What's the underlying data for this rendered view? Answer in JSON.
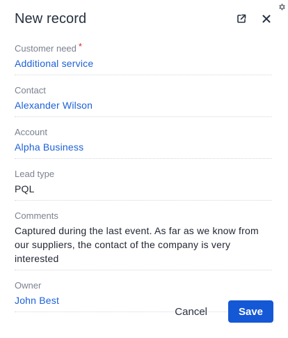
{
  "dialog": {
    "title": "New record"
  },
  "icons": {
    "settings": "gear-icon",
    "open_new": "open-in-new-icon",
    "close": "close-icon"
  },
  "fields": [
    {
      "label": "Customer need",
      "value": "Additional service",
      "required": true,
      "link": true
    },
    {
      "label": "Contact",
      "value": "Alexander Wilson",
      "required": false,
      "link": true
    },
    {
      "label": "Account",
      "value": "Alpha Business",
      "required": false,
      "link": true
    },
    {
      "label": "Lead type",
      "value": "PQL",
      "required": false,
      "link": false
    },
    {
      "label": "Comments",
      "value": "Captured during the last event. As far as we know from our suppliers, the contact of the company is very interested",
      "required": false,
      "link": false
    },
    {
      "label": "Owner",
      "value": "John Best",
      "required": false,
      "link": true
    }
  ],
  "required_mark": "*",
  "footer": {
    "cancel_label": "Cancel",
    "save_label": "Save"
  },
  "colors": {
    "link": "#1b60d8",
    "primary_button": "#1458d6",
    "required": "#d42b2b"
  }
}
